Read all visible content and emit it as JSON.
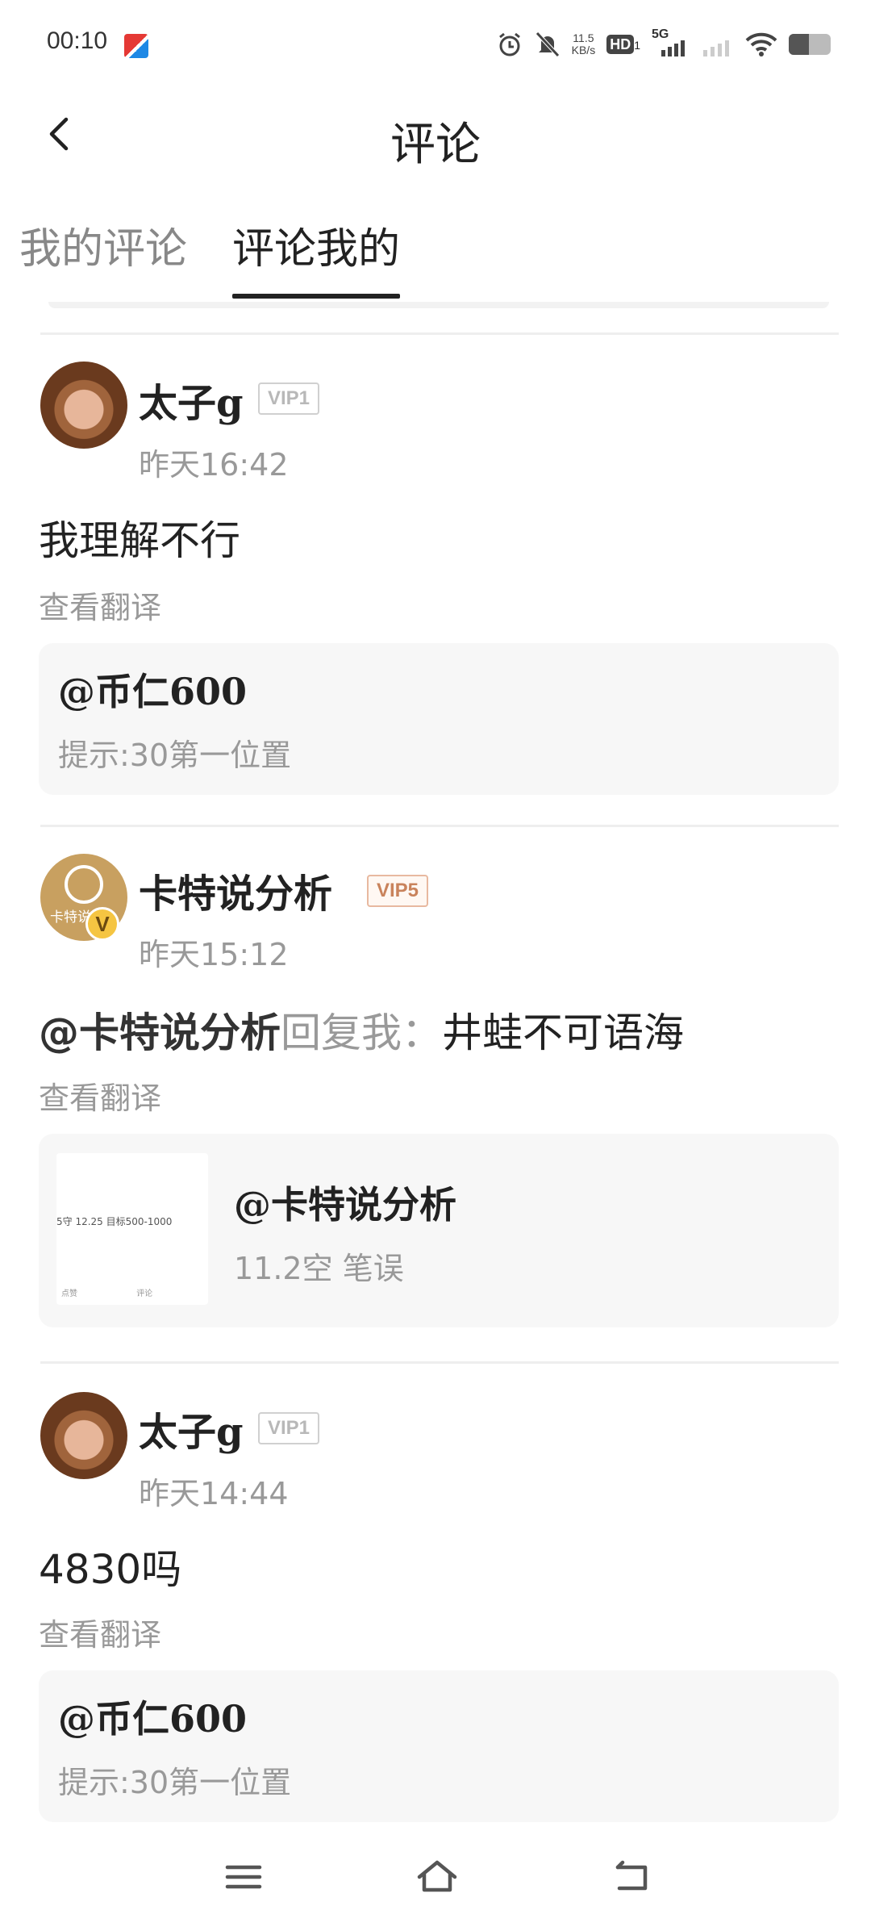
{
  "status_bar": {
    "time": "00:10",
    "net_speed_value": "11.5",
    "net_speed_unit": "KB/s",
    "hd_label": "HD",
    "hd_sub": "1",
    "signal_label": "5G",
    "battery_level": 0.48
  },
  "header": {
    "title": "评论"
  },
  "tabs": [
    {
      "label": "我的评论",
      "active": false
    },
    {
      "label": "评论我的",
      "active": true
    }
  ],
  "comments": [
    {
      "username": "太子g",
      "vip": "VIP1",
      "time": "昨天16:42",
      "text": "我理解不行",
      "translate": "查看翻译",
      "quote": {
        "name": "@币仁600",
        "text": "提示:30第一位置"
      }
    },
    {
      "username": "卡特说分析",
      "vip": "VIP5",
      "avatar_text": "卡特说",
      "verified": "V",
      "time": "昨天15:12",
      "mention": "@卡特说分析",
      "reply_label": "回复我：",
      "text": "井蛙不可语海",
      "translate": "查看翻译",
      "quote": {
        "name": "@卡特说分析",
        "text": "11.2空 笔误",
        "thumb_text": "5守 12.25 目标500-1000",
        "thumb_like": "点赞",
        "thumb_comment": "评论"
      }
    },
    {
      "username": "太子g",
      "vip": "VIP1",
      "time": "昨天14:44",
      "text": "4830吗",
      "translate": "查看翻译",
      "quote": {
        "name": "@币仁600",
        "text": "提示:30第一位置"
      }
    }
  ],
  "icons": {
    "back": "back-arrow-icon",
    "menu": "menu-icon",
    "home": "home-icon",
    "return": "return-icon"
  }
}
